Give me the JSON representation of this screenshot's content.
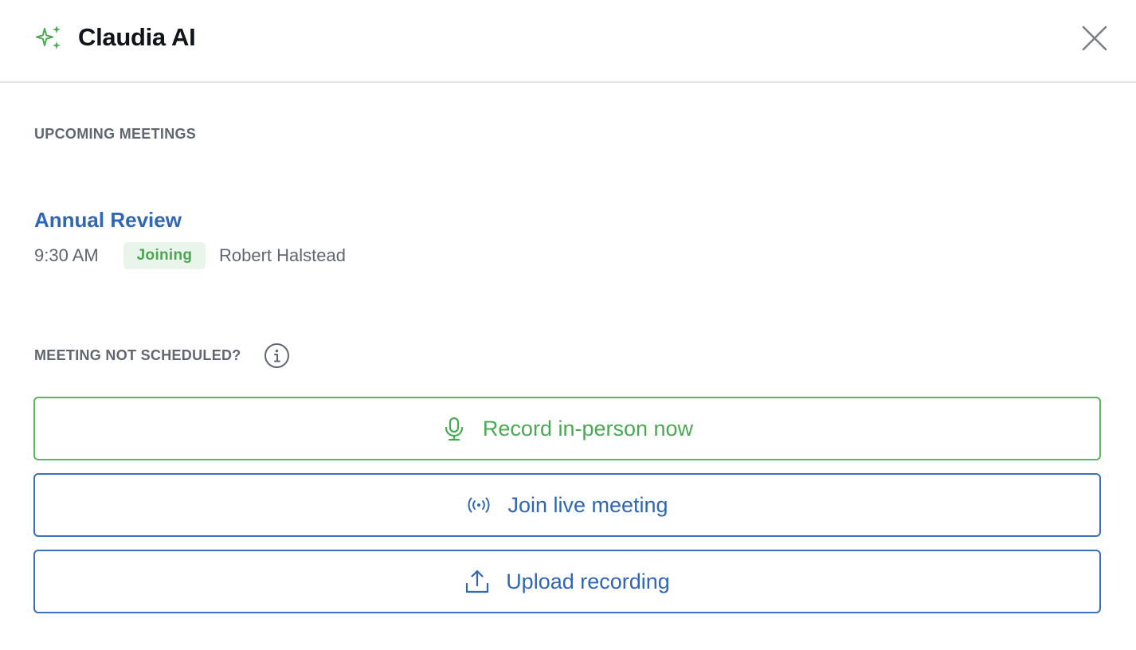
{
  "header": {
    "title": "Claudia AI",
    "brand_icon": "sparkles-icon",
    "close_icon": "close-icon",
    "accent_color": "#4aa853"
  },
  "upcoming": {
    "section_label": "UPCOMING MEETINGS",
    "meetings": [
      {
        "title": "Annual Review",
        "time": "9:30 AM",
        "status": "Joining",
        "attendee": "Robert Halstead"
      }
    ]
  },
  "unscheduled": {
    "section_label": "MEETING NOT SCHEDULED?",
    "info_icon": "info-icon"
  },
  "actions": {
    "record": {
      "label": "Record in-person now",
      "icon": "microphone-icon",
      "color": "#4aa853"
    },
    "join": {
      "label": "Join live meeting",
      "icon": "broadcast-icon",
      "color": "#2f66b5"
    },
    "upload": {
      "label": "Upload recording",
      "icon": "upload-icon",
      "color": "#2f66b5"
    }
  }
}
